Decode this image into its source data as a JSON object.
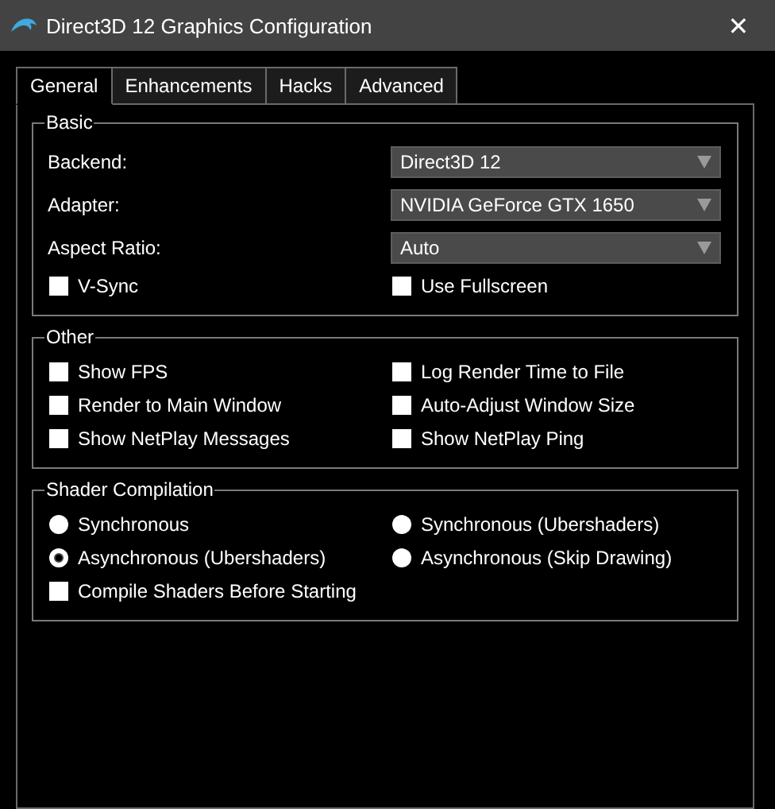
{
  "window": {
    "title": "Direct3D 12 Graphics Configuration",
    "close": "✕"
  },
  "tabs": [
    {
      "label": "General",
      "selected": true
    },
    {
      "label": "Enhancements",
      "selected": false
    },
    {
      "label": "Hacks",
      "selected": false
    },
    {
      "label": "Advanced",
      "selected": false
    }
  ],
  "groups": [
    {
      "title": "Basic",
      "items": [
        {
          "kind": "combo",
          "label": "Backend:",
          "value": "Direct3D 12"
        },
        {
          "kind": "combo",
          "label": "Adapter:",
          "value": "NVIDIA GeForce GTX 1650"
        },
        {
          "kind": "combo",
          "label": "Aspect Ratio:",
          "value": "Auto"
        },
        {
          "kind": "checkbox",
          "label": "V-Sync",
          "checked": false
        },
        {
          "kind": "checkbox",
          "label": "Use Fullscreen",
          "checked": false
        }
      ]
    },
    {
      "title": "Other",
      "items": [
        {
          "kind": "checkbox",
          "label": "Show FPS",
          "checked": false
        },
        {
          "kind": "checkbox",
          "label": "Log Render Time to File",
          "checked": false
        },
        {
          "kind": "checkbox",
          "label": "Render to Main Window",
          "checked": false
        },
        {
          "kind": "checkbox",
          "label": "Auto-Adjust Window Size",
          "checked": false
        },
        {
          "kind": "checkbox",
          "label": "Show NetPlay Messages",
          "checked": false
        },
        {
          "kind": "checkbox",
          "label": "Show NetPlay Ping",
          "checked": false
        }
      ]
    },
    {
      "title": "Shader Compilation",
      "items": [
        {
          "kind": "radio",
          "label": "Synchronous",
          "selected": false
        },
        {
          "kind": "radio",
          "label": "Synchronous (Ubershaders)",
          "selected": false
        },
        {
          "kind": "radio",
          "label": "Asynchronous (Ubershaders)",
          "selected": true
        },
        {
          "kind": "radio",
          "label": "Asynchronous (Skip Drawing)",
          "selected": false
        },
        {
          "kind": "checkbox",
          "label": "Compile Shaders Before Starting",
          "checked": false
        }
      ]
    }
  ]
}
